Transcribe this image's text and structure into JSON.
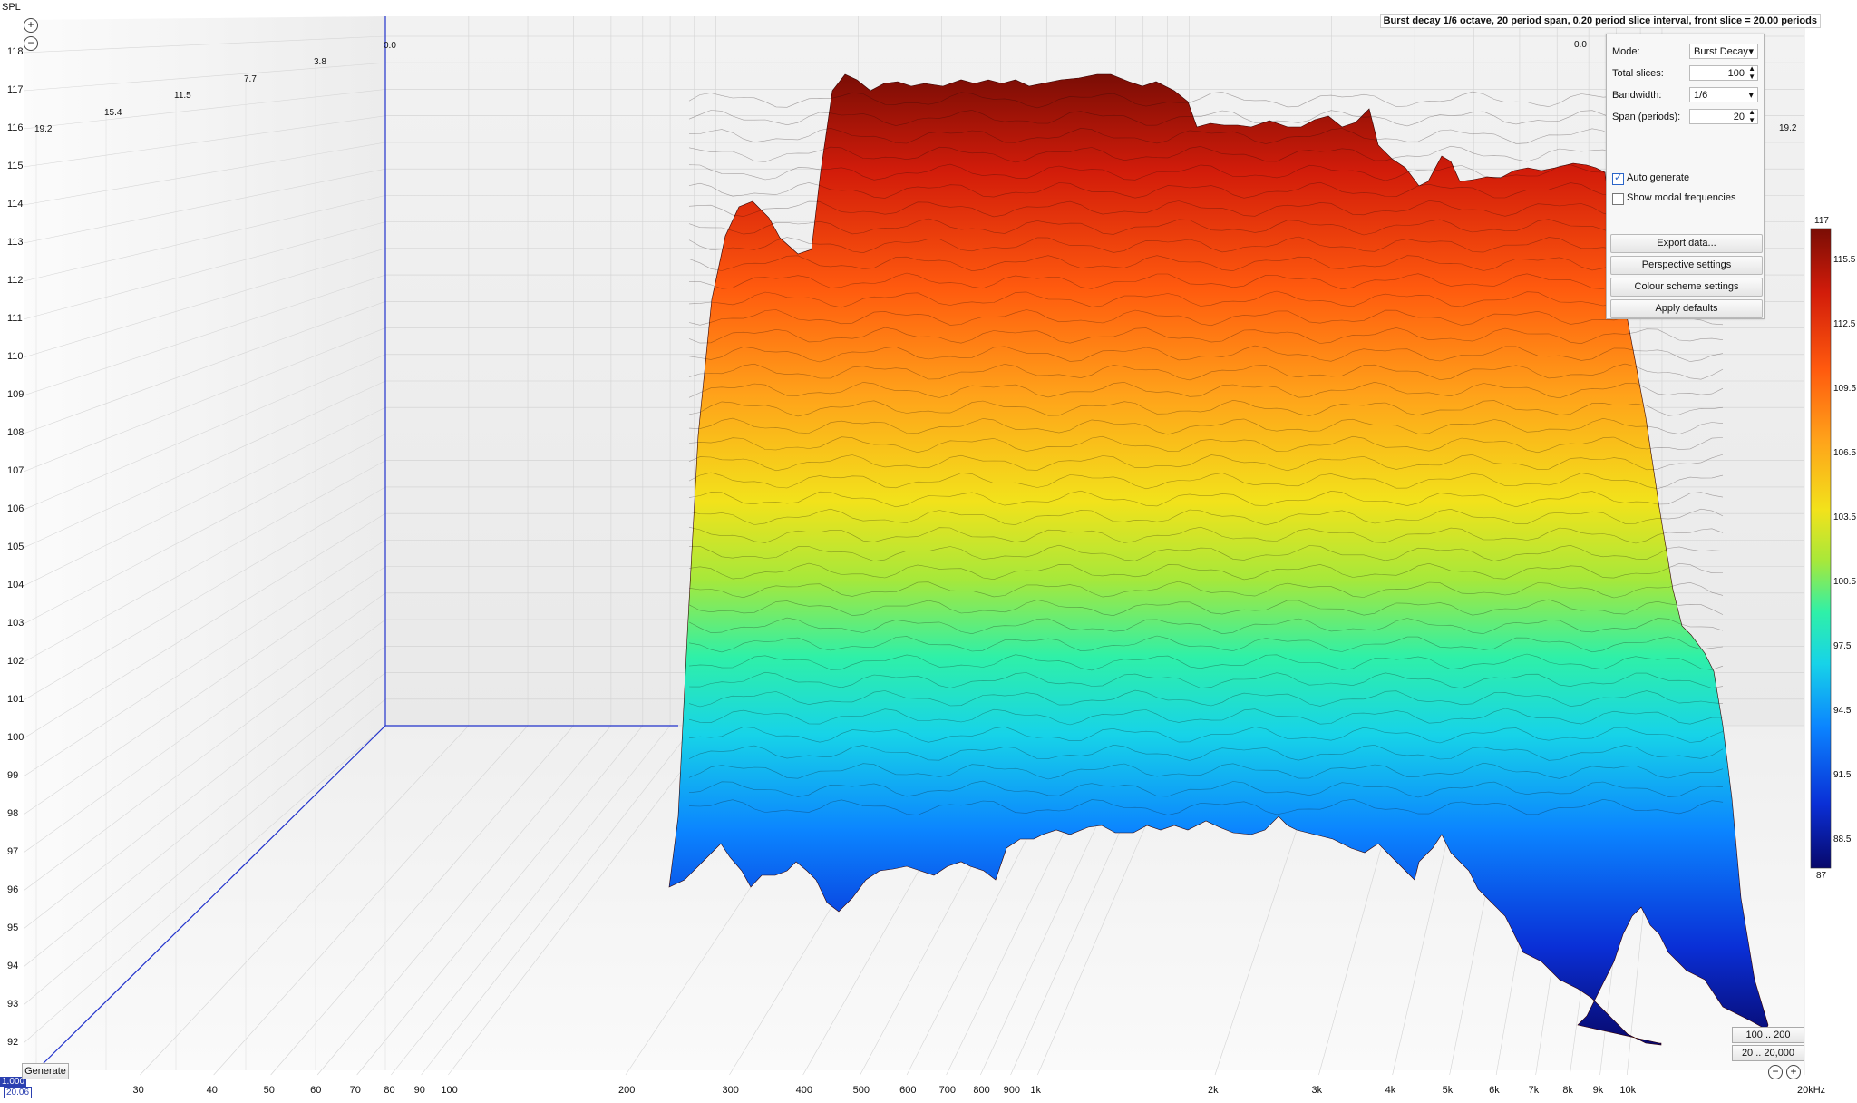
{
  "axis": {
    "y_title": "SPL",
    "y_ticks": [
      "118",
      "117",
      "116",
      "115",
      "114",
      "113",
      "112",
      "111",
      "110",
      "109",
      "108",
      "107",
      "106",
      "105",
      "104",
      "103",
      "102",
      "101",
      "100",
      "99",
      "98",
      "97",
      "96",
      "95",
      "94",
      "93",
      "92"
    ],
    "x_ticks": [
      "30",
      "40",
      "50",
      "60",
      "70",
      "80",
      "90",
      "100",
      "200",
      "300",
      "400",
      "500",
      "600",
      "700",
      "800",
      "900",
      "1k",
      "2k",
      "3k",
      "4k",
      "5k",
      "6k",
      "7k",
      "8k",
      "9k",
      "10k",
      "20kHz"
    ],
    "depth_ticks_left": [
      "19.2",
      "15.4",
      "11.5",
      "7.7",
      "3.8",
      "0.0"
    ],
    "depth_ticks_right": [
      "0.0",
      "19.2"
    ],
    "corner_value_1": "1.000",
    "corner_value_2": "20.06"
  },
  "info_text": "Burst decay 1/6 octave, 20 period span, 0.20 period slice interval,  front slice = 20.00 periods",
  "panel": {
    "mode_label": "Mode:",
    "mode_value": "Burst Decay",
    "slices_label": "Total slices:",
    "slices_value": "100",
    "bandwidth_label": "Bandwidth:",
    "bandwidth_value": "1/6",
    "span_label": "Span (periods):",
    "span_value": "20",
    "auto_generate_label": "Auto generate",
    "auto_generate_checked": true,
    "modal_label": "Show modal frequencies",
    "modal_checked": false,
    "export_label": "Export data...",
    "perspective_label": "Perspective settings",
    "colour_label": "Colour scheme settings",
    "defaults_label": "Apply defaults"
  },
  "colorbar": {
    "max": "117",
    "min": "87",
    "labels": [
      "115.5",
      "112.5",
      "109.5",
      "106.5",
      "103.5",
      "100.5",
      "97.5",
      "94.5",
      "91.5",
      "88.5"
    ]
  },
  "buttons": {
    "generate": "Generate",
    "range_1": "100 .. 200",
    "range_2": "20 .. 20,000"
  },
  "colors": {
    "accent_blue": "#2233cc",
    "grid": "#c8c8c8",
    "spectrum": [
      "#08086b",
      "#0a2fd6",
      "#0b84ff",
      "#17d3e8",
      "#2ff0a8",
      "#a7e83a",
      "#f2e21b",
      "#ffa21a",
      "#ff5a0e",
      "#d21c0a",
      "#7a0d05"
    ]
  },
  "chart_data": {
    "type": "area",
    "title": "Burst decay 1/6 octave, 20 period span, 0.20 period slice interval,  front slice = 20.00 periods",
    "ylabel": "SPL",
    "xlabel": "",
    "x_scale": "log",
    "x_range": [
      20,
      20000
    ],
    "y_range": [
      91.5,
      118.5
    ],
    "colorbar_range": [
      87,
      117
    ],
    "z_range_periods": [
      0,
      19.2
    ],
    "series": [
      {
        "name": "",
        "x": [
          250,
          300,
          340,
          400,
          450,
          480,
          500,
          550,
          600,
          700,
          800,
          900,
          1000,
          1200,
          1500,
          2000,
          2500,
          3000,
          3500,
          4000,
          4500,
          5000,
          5500,
          6000,
          7000,
          8000,
          10000
        ],
        "values": [
          95.5,
          107,
          111.5,
          113.5,
          112,
          113,
          117,
          116.8,
          117,
          116.8,
          116.9,
          117,
          116.8,
          117,
          116.9,
          116.6,
          116.5,
          116.3,
          116.4,
          115.2,
          114.8,
          115.4,
          114.7,
          114.8,
          114.7,
          114.4,
          113
        ]
      }
    ]
  }
}
